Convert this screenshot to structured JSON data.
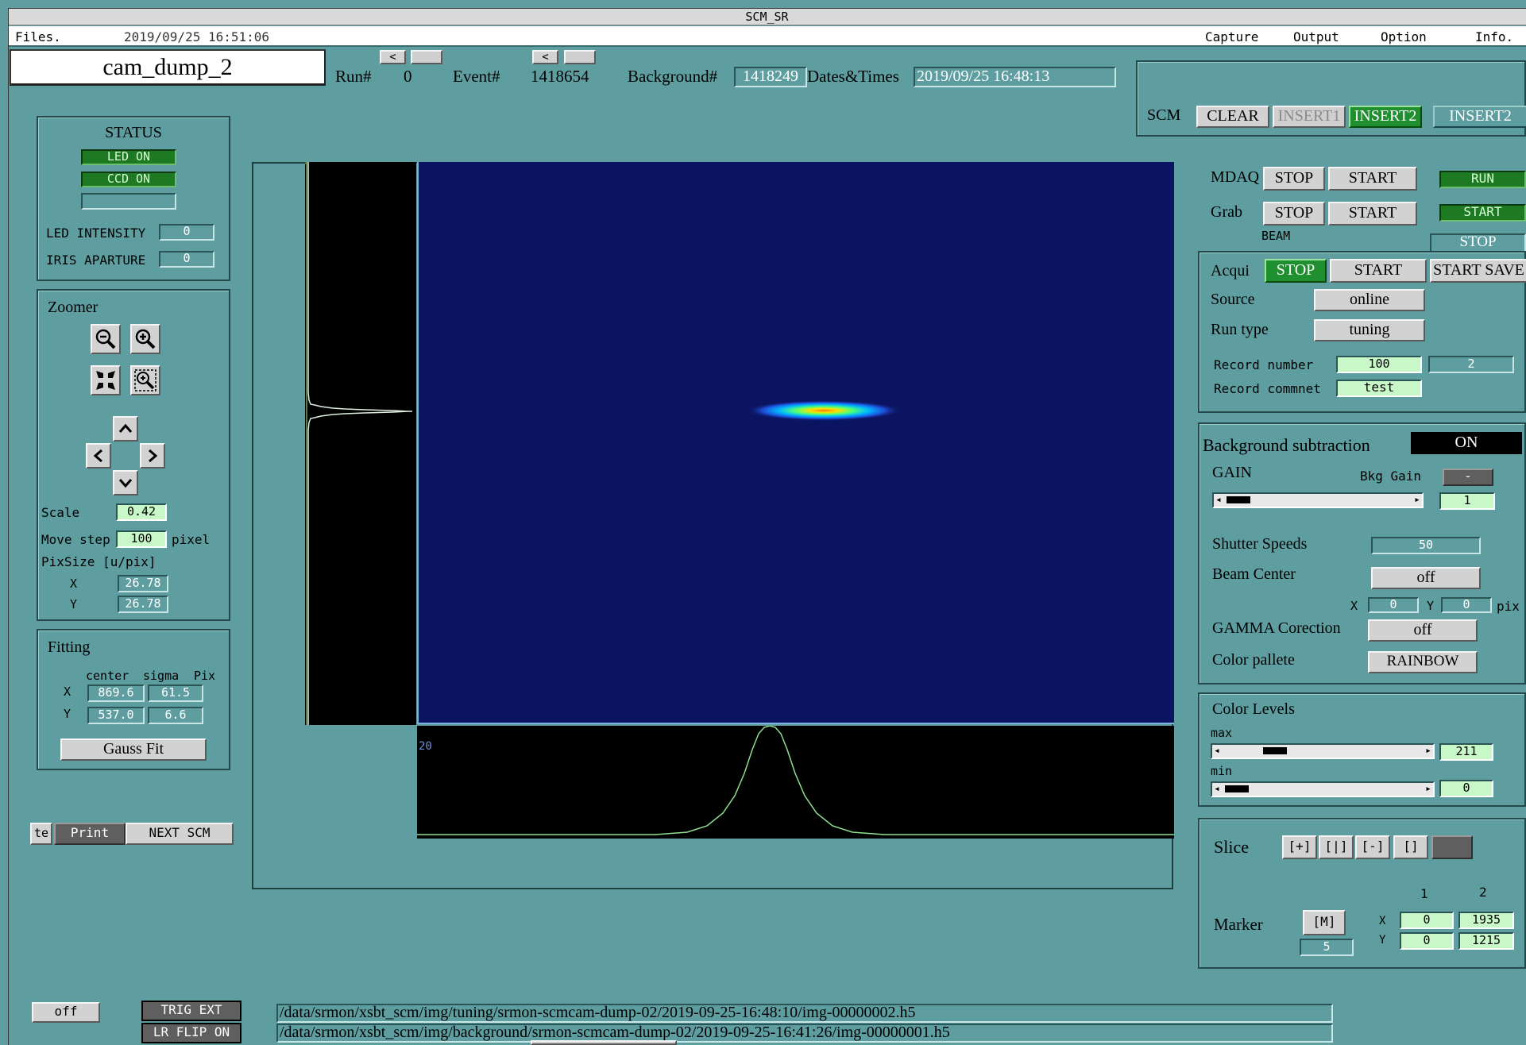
{
  "window": {
    "title": "SCM_SR"
  },
  "menu": {
    "files": "Files.",
    "datetime": "2019/09/25  16:51:06",
    "capture": "Capture",
    "output": "Output",
    "option": "Option",
    "info": "Info."
  },
  "header": {
    "camera": "cam_dump_2",
    "run_label": "Run#",
    "run_value": "0",
    "event_label": "Event#",
    "event_value": "1418654",
    "background_label": "Background#",
    "background_value": "1418249",
    "dates_label": "Dates&Times",
    "dates_value": "2019/09/25 16:48:13",
    "prev_symbol": "<"
  },
  "status": {
    "title": "STATUS",
    "led": "LED ON",
    "ccd": "CCD ON",
    "empty": "",
    "led_intensity_label": "LED INTENSITY",
    "led_intensity_value": "0",
    "iris_label": "IRIS APARTURE",
    "iris_value": "0"
  },
  "zoomer": {
    "title": "Zoomer",
    "scale_label": "Scale",
    "scale_value": "0.42",
    "move_step_label": "Move step",
    "move_step_value": "100",
    "move_step_unit": "pixel",
    "pixsize_label": "PixSize [u/pix]",
    "x_label": "X",
    "x_value": "26.78",
    "y_label": "Y",
    "y_value": "26.78"
  },
  "fitting": {
    "title": "Fitting",
    "col_center": "center",
    "col_sigma": "sigma",
    "col_pix": "Pix",
    "x_label": "X",
    "x_center": "869.6",
    "x_sigma": "61.5",
    "y_label": "Y",
    "y_center": "537.0",
    "y_sigma": "6.6",
    "button": "Gauss Fit"
  },
  "left_buttons": {
    "te": "te",
    "print": "Print",
    "next": "NEXT SCM"
  },
  "bottom": {
    "off": "off",
    "trig": "TRIG EXT",
    "lrflip": "LR FLIP ON",
    "path1": "/data/srmon/xsbt_scm/img/tuning/srmon-scmcam-dump-02/2019-09-25-16:48:10/img-00000002.h5",
    "path2": "/data/srmon/xsbt_scm/img/background/srmon-scmcam-dump-02/2019-09-25-16:41:26/img-00000001.h5"
  },
  "image": {
    "profile_label": "20",
    "colormap": "RAINBOW"
  },
  "scm": {
    "label": "SCM",
    "clear": "CLEAR",
    "insert1": "INSERT1",
    "insert2": "INSERT2",
    "insert2b": "INSERT2"
  },
  "daq": {
    "mdaq_label": "MDAQ",
    "grab_label": "Grab",
    "stop": "STOP",
    "start": "START",
    "run_status": "RUN",
    "start_status": "START",
    "beam_label": "BEAM",
    "beam_stop": "STOP"
  },
  "acqui": {
    "label": "Acqui",
    "stop": "STOP",
    "start": "START",
    "start_save": "START SAVE",
    "source_label": "Source",
    "source_value": "online",
    "runtype_label": "Run type",
    "runtype_value": "tuning",
    "record_number_label": "Record number",
    "record_number_value": "100",
    "record_number_count": "2",
    "record_comment_label": "Record commnet",
    "record_comment_value": "test"
  },
  "settings": {
    "bg_sub_label": "Background subtraction",
    "bg_sub_value": "ON",
    "gain_label": "GAIN",
    "bkg_gain_label": "Bkg Gain",
    "bkg_gain_value": "-",
    "gain_value": "1",
    "shutter_label": "Shutter Speeds",
    "shutter_value": "50",
    "beam_center_label": "Beam Center",
    "beam_center_value": "off",
    "x_label": "X",
    "x_value": "0",
    "y_label": "Y",
    "y_value": "0",
    "pix_unit": "pix",
    "gamma_label": "GAMMA Corection",
    "gamma_value": "off",
    "palette_label": "Color pallete",
    "palette_value": "RAINBOW"
  },
  "levels": {
    "title": "Color Levels",
    "max_label": "max",
    "max_value": "211",
    "max_level": 0.22,
    "min_label": "min",
    "min_value": "0",
    "min_level": 0.0
  },
  "slice": {
    "label": "Slice",
    "b1": "[+]",
    "b2": "[|]",
    "b3": "[-]",
    "b4": "[]",
    "col1": "1",
    "col2": "2",
    "marker_label": "Marker",
    "marker_button": "[M]",
    "marker_size": "5",
    "x_label": "X",
    "y_label": "Y",
    "x1": "0",
    "x2": "1935",
    "y1": "0",
    "y2": "1215"
  },
  "colors": {
    "background": "#5f9ea0",
    "image_bg": "#0b1460",
    "led_green": "#1f8f2f"
  }
}
